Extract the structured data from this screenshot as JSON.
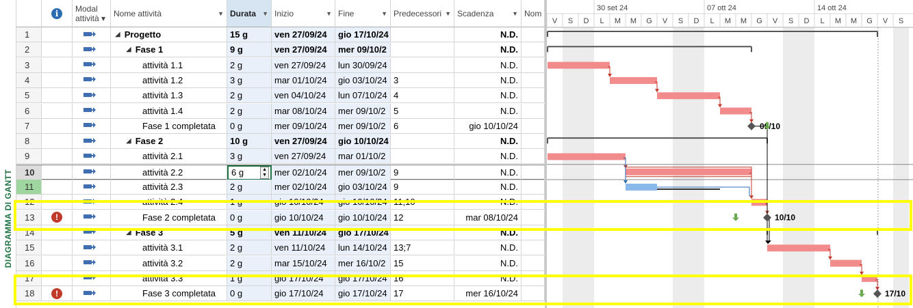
{
  "view_bar": {
    "label": "DIAGRAMMA DI GANTT"
  },
  "columns": {
    "info": "i",
    "mode": [
      "Modal",
      "attività"
    ],
    "name": "Nome attività",
    "duration": "Durata",
    "start": "Inizio",
    "finish": "Fine",
    "predecessors": "Predecessori",
    "deadline": "Scadenza",
    "resource": "Nom"
  },
  "colors": {
    "bar_critical": "#f28b8b",
    "bar_normal": "#8ab8ea",
    "summary": "#555555",
    "milestone": "#555555",
    "deadline_arrow": "#6aa84f",
    "highlight": "#ffff00",
    "weekend": "#ececec"
  },
  "gantt": {
    "weeks": [
      "30 set 24",
      "07 ott 24",
      "14 ott 24"
    ],
    "days": [
      "V",
      "S",
      "D",
      "L",
      "M",
      "M",
      "G",
      "V",
      "S",
      "D",
      "L",
      "M",
      "M",
      "G",
      "V",
      "S",
      "D",
      "L",
      "M",
      "M",
      "G",
      "V",
      "S"
    ],
    "labels": {
      "m1": "09/10",
      "m2": "10/10",
      "m3": "17/10"
    }
  },
  "rows": [
    {
      "id": "1",
      "ind": "",
      "name": "Progetto",
      "dur": "15 g",
      "start": "ven 27/09/24",
      "finish": "gio 17/10/24",
      "pred": "",
      "deadline": "N.D.",
      "bold": true,
      "level": 0,
      "summary": true
    },
    {
      "id": "2",
      "ind": "",
      "name": "Fase 1",
      "dur": "9 g",
      "start": "ven 27/09/24",
      "finish": "mer 09/10/2",
      "pred": "",
      "deadline": "N.D.",
      "bold": true,
      "level": 1,
      "summary": true
    },
    {
      "id": "3",
      "ind": "",
      "name": "attività 1.1",
      "dur": "2 g",
      "start": "ven 27/09/24",
      "finish": "lun 30/09/24",
      "pred": "",
      "deadline": "N.D.",
      "bold": false,
      "level": 2
    },
    {
      "id": "4",
      "ind": "",
      "name": "attività 1.2",
      "dur": "3 g",
      "start": "mar 01/10/24",
      "finish": "gio 03/10/24",
      "pred": "3",
      "deadline": "N.D.",
      "bold": false,
      "level": 2
    },
    {
      "id": "5",
      "ind": "",
      "name": "attività 1.3",
      "dur": "2 g",
      "start": "ven 04/10/24",
      "finish": "lun 07/10/24",
      "pred": "4",
      "deadline": "N.D.",
      "bold": false,
      "level": 2
    },
    {
      "id": "6",
      "ind": "",
      "name": "attività 1.4",
      "dur": "2 g",
      "start": "mar 08/10/24",
      "finish": "mer 09/10/2",
      "pred": "5",
      "deadline": "N.D.",
      "bold": false,
      "level": 2
    },
    {
      "id": "7",
      "ind": "",
      "name": "Fase 1 completata",
      "dur": "0 g",
      "start": "mer 09/10/24",
      "finish": "mer 09/10/2",
      "pred": "6",
      "deadline": "gio 10/10/24",
      "bold": false,
      "level": 2
    },
    {
      "id": "8",
      "ind": "",
      "name": "Fase 2",
      "dur": "10 g",
      "start": "ven 27/09/24",
      "finish": "gio 10/10/24",
      "pred": "",
      "deadline": "N.D.",
      "bold": true,
      "level": 1,
      "summary": true
    },
    {
      "id": "9",
      "ind": "",
      "name": "attività 2.1",
      "dur": "3 g",
      "start": "ven 27/09/24",
      "finish": "mar 01/10/2",
      "pred": "",
      "deadline": "N.D.",
      "bold": false,
      "level": 2
    },
    {
      "id": "10",
      "ind": "",
      "name": "attività 2.2",
      "dur": "6 g",
      "start": "mer 02/10/24",
      "finish": "mer 09/10/2",
      "pred": "9",
      "deadline": "N.D.",
      "bold": false,
      "level": 2,
      "selected": true
    },
    {
      "id": "11",
      "ind": "",
      "name": "attività 2.3",
      "dur": "2 g",
      "start": "mer 02/10/24",
      "finish": "gio 03/10/24",
      "pred": "9",
      "deadline": "N.D.",
      "bold": false,
      "level": 2
    },
    {
      "id": "12",
      "ind": "",
      "name": "attività 2.4",
      "dur": "1 g",
      "start": "gio 10/10/24",
      "finish": "gio 10/10/24",
      "pred": "11;10",
      "deadline": "N.D.",
      "bold": false,
      "level": 2
    },
    {
      "id": "13",
      "ind": "!",
      "name": "Fase 2 completata",
      "dur": "0 g",
      "start": "gio 10/10/24",
      "finish": "gio 10/10/24",
      "pred": "12",
      "deadline": "mar 08/10/24",
      "bold": false,
      "level": 2
    },
    {
      "id": "14",
      "ind": "",
      "name": "Fase 3",
      "dur": "5 g",
      "start": "ven 11/10/24",
      "finish": "gio 17/10/24",
      "pred": "",
      "deadline": "N.D.",
      "bold": true,
      "level": 1,
      "summary": true
    },
    {
      "id": "15",
      "ind": "",
      "name": "attività 3.1",
      "dur": "2 g",
      "start": "ven 11/10/24",
      "finish": "lun 14/10/24",
      "pred": "13;7",
      "deadline": "N.D.",
      "bold": false,
      "level": 2
    },
    {
      "id": "16",
      "ind": "",
      "name": "attività 3.2",
      "dur": "2 g",
      "start": "mar 15/10/24",
      "finish": "mer 16/10/2",
      "pred": "15",
      "deadline": "N.D.",
      "bold": false,
      "level": 2
    },
    {
      "id": "17",
      "ind": "",
      "name": "attività 3.3",
      "dur": "1 g",
      "start": "gio 17/10/24",
      "finish": "gio 17/10/24",
      "pred": "16",
      "deadline": "N.D.",
      "bold": false,
      "level": 2
    },
    {
      "id": "18",
      "ind": "!",
      "name": "Fase 3 completata",
      "dur": "0 g",
      "start": "gio 17/10/24",
      "finish": "gio 17/10/24",
      "pred": "17",
      "deadline": "mer 16/10/24",
      "bold": false,
      "level": 2
    }
  ]
}
